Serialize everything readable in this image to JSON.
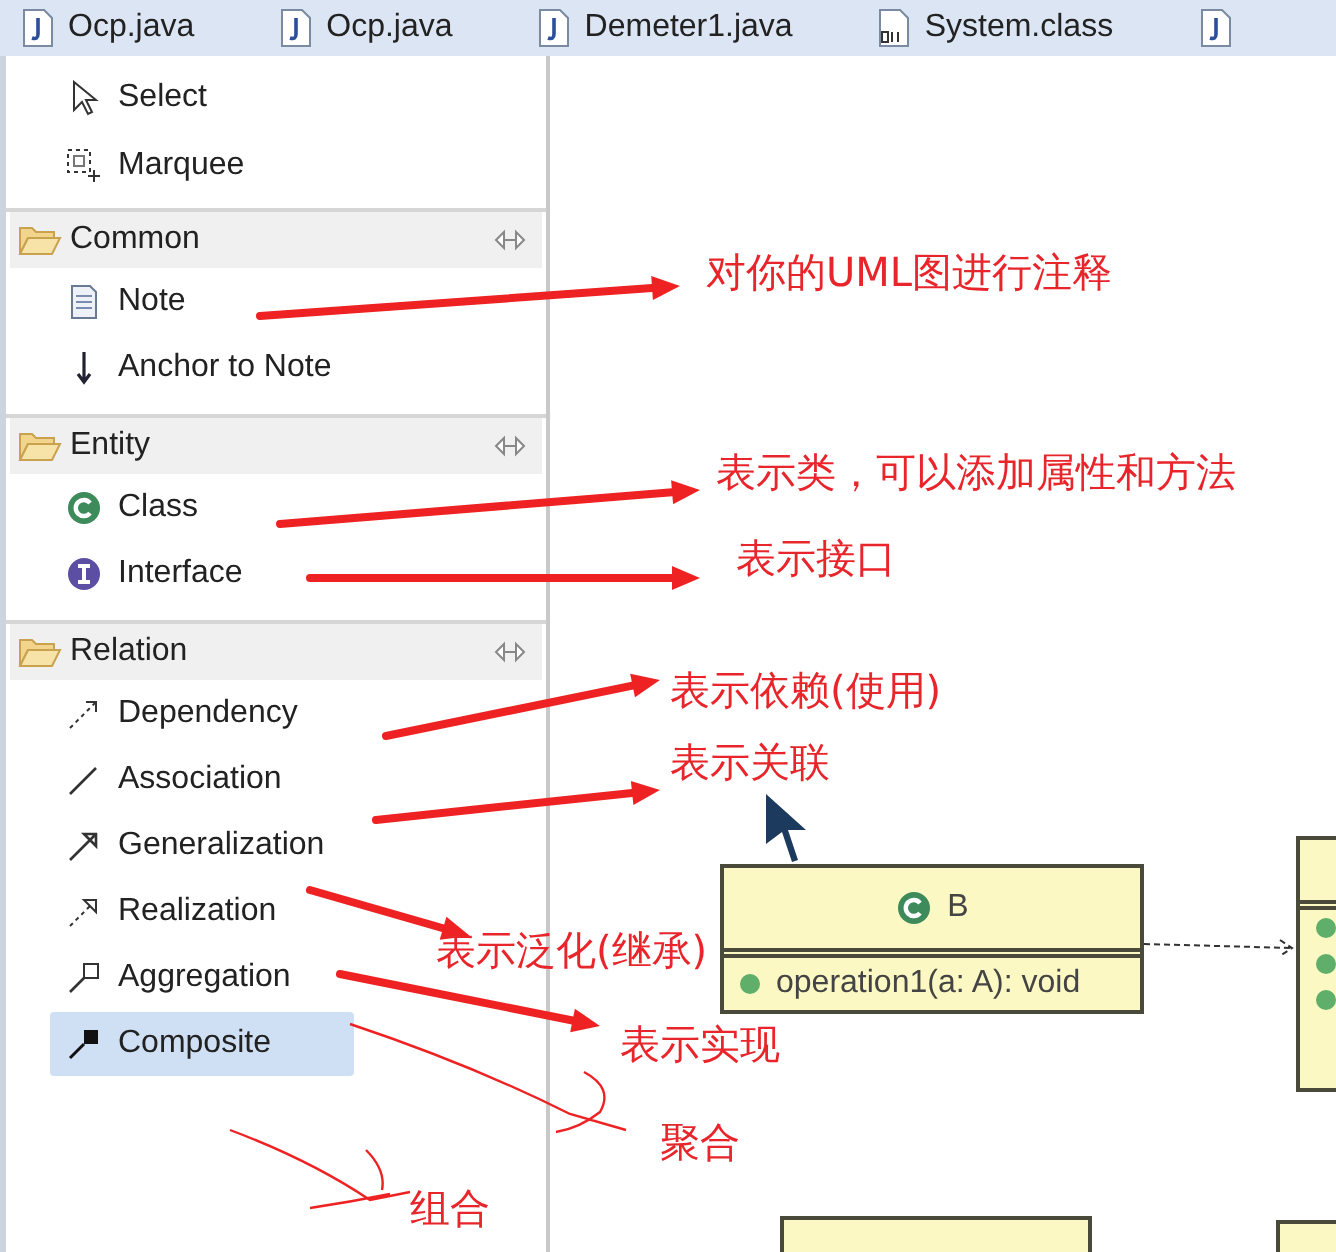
{
  "tabs": [
    {
      "label": "Ocp.java",
      "kind": "java"
    },
    {
      "label": "Ocp.java",
      "kind": "java"
    },
    {
      "label": "Demeter1.java",
      "kind": "java"
    },
    {
      "label": "System.class",
      "kind": "class"
    },
    {
      "kind": "java"
    }
  ],
  "palette": {
    "tools": [
      {
        "label": "Select",
        "kind": "select"
      },
      {
        "label": "Marquee",
        "kind": "marquee"
      }
    ],
    "groups": [
      {
        "title": "Common",
        "items": [
          {
            "label": "Note",
            "kind": "note",
            "selected": false
          },
          {
            "label": "Anchor to Note",
            "kind": "anchor",
            "selected": false
          }
        ]
      },
      {
        "title": "Entity",
        "items": [
          {
            "label": "Class",
            "kind": "class",
            "selected": false
          },
          {
            "label": "Interface",
            "kind": "interface",
            "selected": false
          }
        ]
      },
      {
        "title": "Relation",
        "items": [
          {
            "label": "Dependency",
            "kind": "dependency",
            "selected": false
          },
          {
            "label": "Association",
            "kind": "association",
            "selected": false
          },
          {
            "label": "Generalization",
            "kind": "generalization",
            "selected": false
          },
          {
            "label": "Realization",
            "kind": "realization",
            "selected": false
          },
          {
            "label": "Aggregation",
            "kind": "aggregation",
            "selected": false
          },
          {
            "label": "Composite",
            "kind": "composite",
            "selected": true
          }
        ]
      }
    ]
  },
  "canvas": {
    "classes": [
      {
        "name": "B",
        "operations": [
          "operation1(a: A): void"
        ]
      }
    ]
  },
  "annotations": [
    {
      "text": "对你的UML图进行注释"
    },
    {
      "text": "表示类，可以添加属性和方法"
    },
    {
      "text": "表示接口"
    },
    {
      "text": "表示依赖(使用)"
    },
    {
      "text": "表示关联"
    },
    {
      "text": "表示泛化(继承)"
    },
    {
      "text": "表示实现"
    },
    {
      "text": "聚合"
    },
    {
      "text": "组合"
    }
  ]
}
